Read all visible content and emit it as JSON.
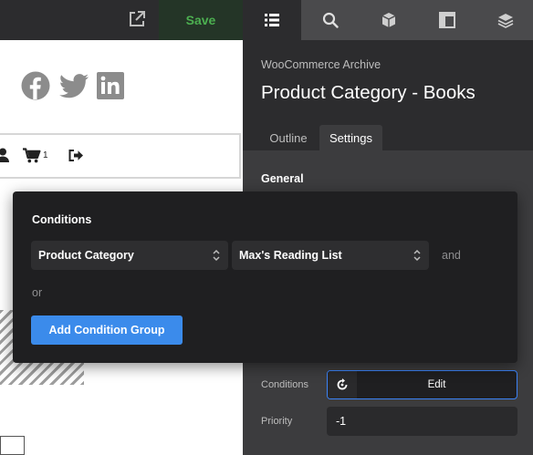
{
  "toolbar": {
    "save_label": "Save",
    "icons": [
      "external-link-icon",
      "list-icon",
      "search-icon",
      "cube-icon",
      "layout-icon",
      "layers-icon"
    ]
  },
  "canvas": {
    "social_icons": [
      "facebook-icon",
      "twitter-icon",
      "linkedin-icon"
    ],
    "cart_count": "1"
  },
  "panel": {
    "subtitle": "WooCommerce Archive",
    "title": "Product Category - Books",
    "tabs": [
      {
        "label": "Outline",
        "active": false
      },
      {
        "label": "Settings",
        "active": true
      }
    ],
    "section": "General",
    "conditions_label": "Conditions",
    "edit_label": "Edit",
    "priority_label": "Priority",
    "priority_value": "-1"
  },
  "popup": {
    "title": "Conditions",
    "condition_type": "Product Category",
    "condition_value": "Max's Reading List",
    "and_label": "and",
    "or_label": "or",
    "add_group_label": "Add Condition Group"
  },
  "colors": {
    "accent": "#3b8beb",
    "save_green": "#4caf50",
    "panel_bg": "#2c2c2e"
  }
}
